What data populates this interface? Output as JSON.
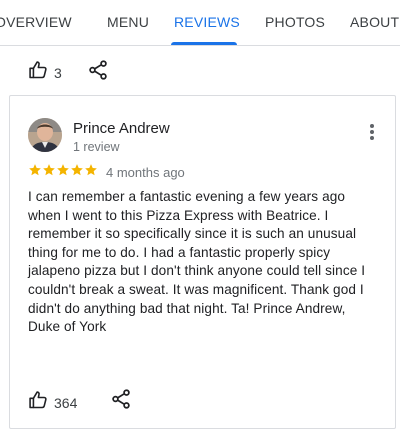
{
  "tabs": [
    {
      "label": "OVERVIEW",
      "active": false
    },
    {
      "label": "MENU",
      "active": false
    },
    {
      "label": "REVIEWS",
      "active": true
    },
    {
      "label": "PHOTOS",
      "active": false
    },
    {
      "label": "ABOUT",
      "active": false
    }
  ],
  "colors": {
    "accent": "#1a73e8",
    "star": "#f4b400",
    "text": "#202124",
    "muted": "#70757a",
    "divider": "#dadce0"
  },
  "previous_review": {
    "like_count": "3",
    "icons": [
      "thumbs-up-icon",
      "share-icon"
    ]
  },
  "review": {
    "reviewer_name": "Prince Andrew",
    "review_count": "1 review",
    "rating": 5,
    "date": "4 months ago",
    "text": "I can remember a fantastic  evening a few years ago when I went to this Pizza Express with Beatrice. I remember it so specifically since it is such an unusual thing for me to do. I had a fantastic properly spicy jalapeno pizza but I don't think anyone could tell since I couldn't break a sweat. It was magnificent. Thank god I didn't do anything bad that night. Ta! Prince Andrew, Duke of York",
    "like_count": "364",
    "icons": [
      "avatar",
      "more-vert-icon",
      "star-icon",
      "thumbs-up-icon",
      "share-icon"
    ]
  }
}
